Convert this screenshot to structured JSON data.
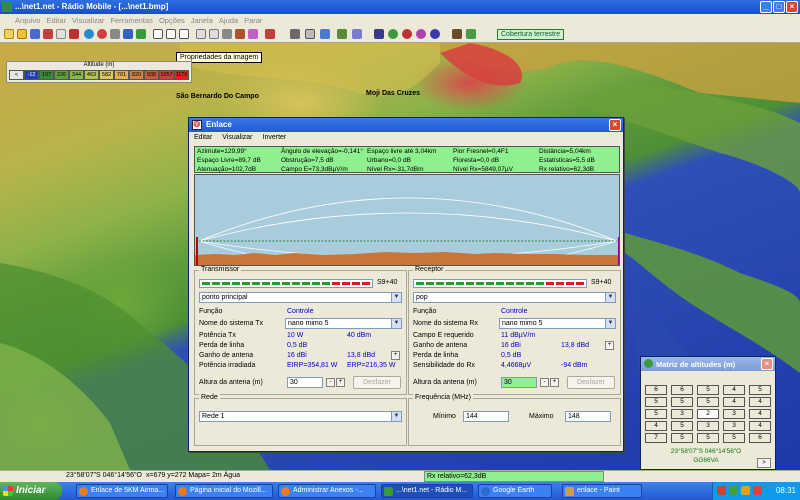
{
  "window": {
    "title": "...\\net1.net - Rádio Mobile - [...\\net1.bmp]"
  },
  "menu": [
    "Arquivo",
    "Editar",
    "Visualizar",
    "Ferramentas",
    "Opções",
    "Janela",
    "Ajuda",
    "Parar"
  ],
  "toolbar": {
    "coverage_label": "Cobertura terrestre"
  },
  "tooltip": "Propriedades da imagem",
  "legend": {
    "title": "Altitude (m)",
    "ticks": [
      "<",
      "-12",
      "107",
      "226",
      "344",
      "463",
      "582",
      "701",
      "820",
      "938",
      "1057",
      "1176"
    ],
    "colors": [
      "#e6e6e6",
      "#2040b0",
      "#3a8a3a",
      "#5ea040",
      "#8ab848",
      "#b6c450",
      "#d8c85a",
      "#e0b050",
      "#d08040",
      "#c85a3a",
      "#d43c3c",
      "#e82020"
    ]
  },
  "map": {
    "labels": [
      "São Bernardo Do Campo",
      "Moji Das Cruzes"
    ]
  },
  "enlace": {
    "title": "Enlace",
    "menu": [
      "Editar",
      "Visualizar",
      "Inverter"
    ],
    "info": [
      [
        "Azimute=129,99°",
        "Ângulo de elevação=-0,141°",
        "Espaço livre até 3,04km",
        "Pior Fresnel=0,4F1",
        "Distância=5,04km"
      ],
      [
        "Espaço Livre=89,7 dB",
        "Obstrução=7,5 dB",
        "Urbano=0,0 dB",
        "Floresta=0,0 dB",
        "Estatísticas=5,5 dB"
      ],
      [
        "Atenuação=102,7dB",
        "Campo E=73,3dBµV/m",
        "Nível Rx=-31,7dBm",
        "Nível Rx=5849,07µV",
        "Rx relativo=62,3dB"
      ]
    ],
    "tx": {
      "title": "Transmissor",
      "signal": "S9+40",
      "station": "ponto principal",
      "funcao_label": "Função",
      "funcao_value": "Controle",
      "system_label": "Nome do sistema Tx",
      "system_value": "nano mimo 5",
      "rows": [
        {
          "label": "Potência Tx",
          "v1": "10 W",
          "v2": "40 dBm"
        },
        {
          "label": "Perda de linha",
          "v1": "0,5 dB",
          "v2": ""
        },
        {
          "label": "Ganho de antena",
          "v1": "16 dBi",
          "v2": "13,8 dBd"
        },
        {
          "label": "Potência irradiada",
          "v1": "EIRP=354,81 W",
          "v2": "ERP=216,35 W"
        }
      ],
      "height_label": "Altura da antena (m)",
      "height_value": "30",
      "undo_label": "Desfazer"
    },
    "rx": {
      "title": "Receptor",
      "signal": "S9+40",
      "station": "pop",
      "funcao_label": "Função",
      "funcao_value": "Controle",
      "system_label": "Nome do sistema Rx",
      "system_value": "nano mimo 5",
      "rows": [
        {
          "label": "Campo E requerido",
          "v1": "11 dBµV/m",
          "v2": ""
        },
        {
          "label": "Ganho de antena",
          "v1": "16 dBi",
          "v2": "13,8 dBd"
        },
        {
          "label": "Perda de linha",
          "v1": "0,5 dB",
          "v2": ""
        },
        {
          "label": "Sensibilidade do Rx",
          "v1": "4,4668µV",
          "v2": "-94 dBm"
        }
      ],
      "height_label": "Altura da antena (m)",
      "height_value": "30",
      "undo_label": "Desfazer"
    },
    "rede": {
      "title": "Rede",
      "value": "Rede 1"
    },
    "freq": {
      "title": "Frequência (MHz)",
      "min_label": "Mínimo",
      "min_value": "144",
      "max_label": "Máximo",
      "max_value": "148"
    }
  },
  "matriz": {
    "title": "Matriz de altitudes (m)",
    "grid": [
      [
        "6",
        "6",
        "5",
        "4",
        "5"
      ],
      [
        "5",
        "5",
        "5",
        "4",
        "4"
      ],
      [
        "5",
        "3",
        "2",
        "3",
        "4"
      ],
      [
        "4",
        "5",
        "3",
        "3",
        "4"
      ],
      [
        "7",
        "5",
        "5",
        "5",
        "6"
      ]
    ],
    "coords": "23°58'07\"S  046°14'56\"O",
    "locator": "GG66VA",
    "next": ">"
  },
  "status": {
    "coords": "23°58'07\"S  046°14'56\"O",
    "pixel": "x=679 y=272 Mapa= 2m Água",
    "rel": "Rx relativo=62,3dB"
  },
  "taskbar": {
    "start": "Iniciar",
    "tasks": [
      "Enlace de 5KM Airma...",
      "Página inicial do Mozill...",
      "Administrar Anexos -...",
      "...\\net1.net - Rádio M...",
      "Google Earth",
      "enlace - Paint"
    ],
    "clock": "08:31"
  }
}
